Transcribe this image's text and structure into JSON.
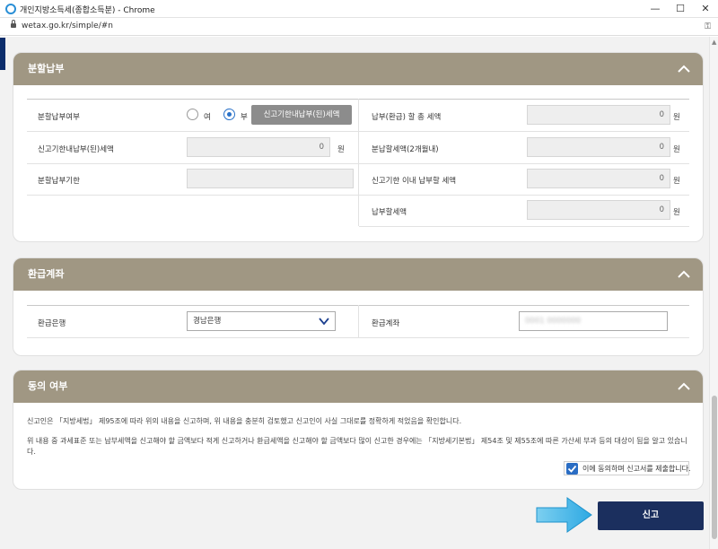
{
  "window": {
    "title": "개인지방소득세(종합소득분) - Chrome",
    "url": "wetax.go.kr/simple/#n",
    "controls": [
      "—",
      "☐",
      "✕"
    ]
  },
  "installment": {
    "header": "분할납부",
    "rows": {
      "installment_flag_label": "분할납부여부",
      "radio_yes_label": "여",
      "radio_no_label": "부",
      "radio_selected": "부",
      "button_label": "신고기한내납부(된)세액",
      "total_tax_label": "납부(환급) 할 총 세액",
      "total_tax_value": "0",
      "paid_in_deadline_label": "신고기한내납부(된)세액",
      "paid_in_deadline_value": "0",
      "installment_amount_label": "분납할세액(2개월내)",
      "installment_amount_value": "0",
      "installment_deadline_label": "분할납부기한",
      "installment_deadline_value": "",
      "pay_within_deadline_label": "신고기한 이내 납부할 세액",
      "pay_within_deadline_value": "0",
      "tax_to_pay_label": "납부할세액",
      "tax_to_pay_value": "0",
      "unit": "원"
    }
  },
  "refund": {
    "header": "환급계좌",
    "bank_label": "환급은행",
    "bank_selected": "경남은행",
    "account_label": "환급계좌",
    "account_value": "0001 0000000"
  },
  "consent": {
    "header": "동의 여부",
    "text1": "신고인은 「지방세법」 제95조에 따라 위의 내용을 신고하며, 위 내용을 충분히 검토했고 신고인이 사실 그대로를 정확하게 적었음을 확인합니다.",
    "text2": "위 내용 중 과세표준 또는 납부세액을 신고해야 할 금액보다 적게 신고하거나 환급세액을 신고해야 할 금액보다 많이 신고한 경우에는 「지방세기본법」 제54조 및 제55조에 따른 가산세 부과 등의 대상이 됨을 알고 있습니다.",
    "checkbox_label": "이에 동의하며 신고서를 제출합니다.",
    "checked": true
  },
  "submit_label": "신고",
  "colors": {
    "panel_header": "#a09783",
    "submit_bg": "#1b2f5e",
    "check_blue": "#2a6dc4"
  }
}
